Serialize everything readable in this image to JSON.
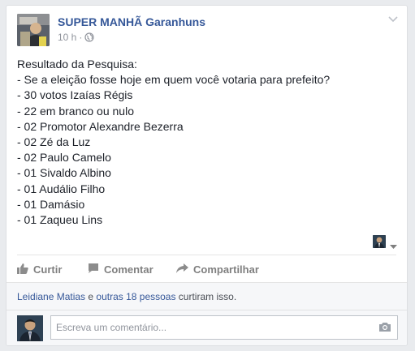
{
  "post": {
    "page_name": "SUPER MANHÃ Garanhuns",
    "time": "10 h",
    "separator": "·",
    "lines": [
      "Resultado da Pesquisa:",
      "- Se a eleição fosse hoje em quem você votaria para prefeito?",
      "- 30 votos Izaías Régis",
      "- 22 em branco ou nulo",
      "- 02 Promotor Alexandre Bezerra",
      "- 02 Zé da Luz",
      "- 02 Paulo Camelo",
      "- 01 Sivaldo Albino",
      "- 01 Audálio Filho",
      "- 01 Damásio",
      "- 01 Zaqueu Lins"
    ]
  },
  "actions": {
    "like": "Curtir",
    "comment": "Comentar",
    "share": "Compartilhar"
  },
  "reactions": {
    "user": "Leidiane Matias",
    "conjunction": " e ",
    "others": "outras 18 pessoas",
    "suffix": " curtiram isso."
  },
  "comment_box": {
    "placeholder": "Escreva um comentário..."
  },
  "icons": {
    "options": "chevron-down-icon",
    "privacy": "globe-icon",
    "like": "thumbs-up-icon",
    "comment": "speech-bubble-icon",
    "share": "share-arrow-icon",
    "camera": "camera-icon"
  },
  "colors": {
    "link": "#365899",
    "background": "#e9ebee",
    "card": "#ffffff",
    "action_text": "#7f7f7f"
  }
}
